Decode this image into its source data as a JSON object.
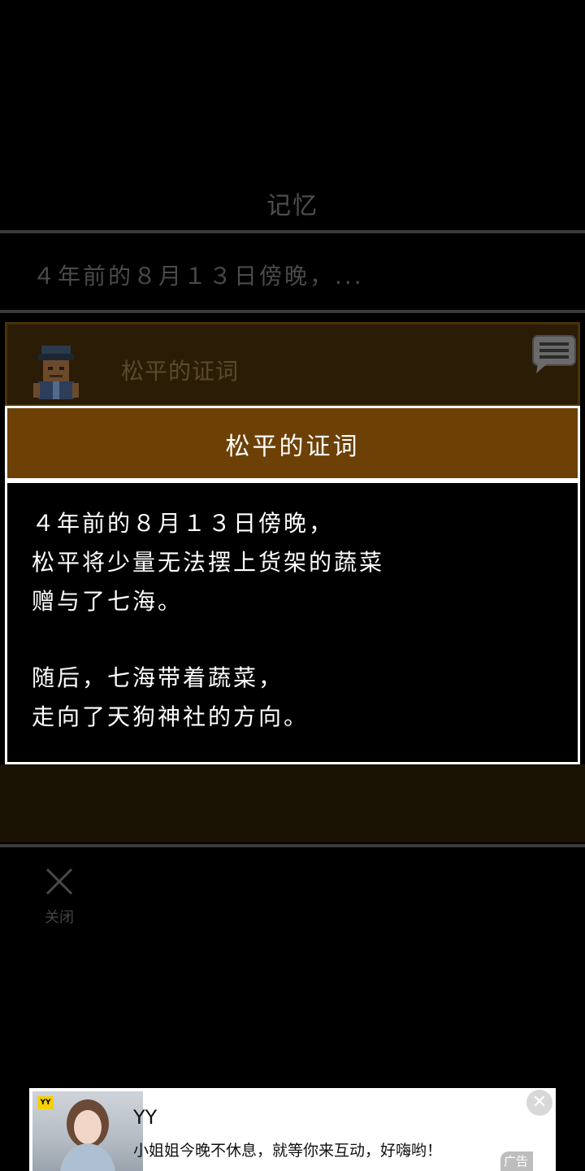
{
  "memory": {
    "title": "记忆",
    "summary": "４年前的８月１３日傍晚，..."
  },
  "entry": {
    "name": "松平的证词",
    "avatar_icon": "character-portrait-icon",
    "chat_icon": "speech-bubble-icon"
  },
  "dialog": {
    "title": "松平的证词",
    "lines": [
      "４年前的８月１３日傍晚，",
      "松平将少量无法摆上货架的蔬菜",
      "赠与了七海。",
      "随后，七海带着蔬菜，",
      "走向了天狗神社的方向。"
    ]
  },
  "close": {
    "label": "关闭",
    "icon": "close-x-icon"
  },
  "ad": {
    "badge": "YY",
    "title": "YY",
    "text": "小姐姐今晚不休息，就等你来互动，好嗨哟！",
    "tag": "广告",
    "close_icon": "ad-close-icon"
  },
  "colors": {
    "dialog_header": "#6d4106",
    "entry_bg": "#2a1c05",
    "border": "#ffffff"
  }
}
